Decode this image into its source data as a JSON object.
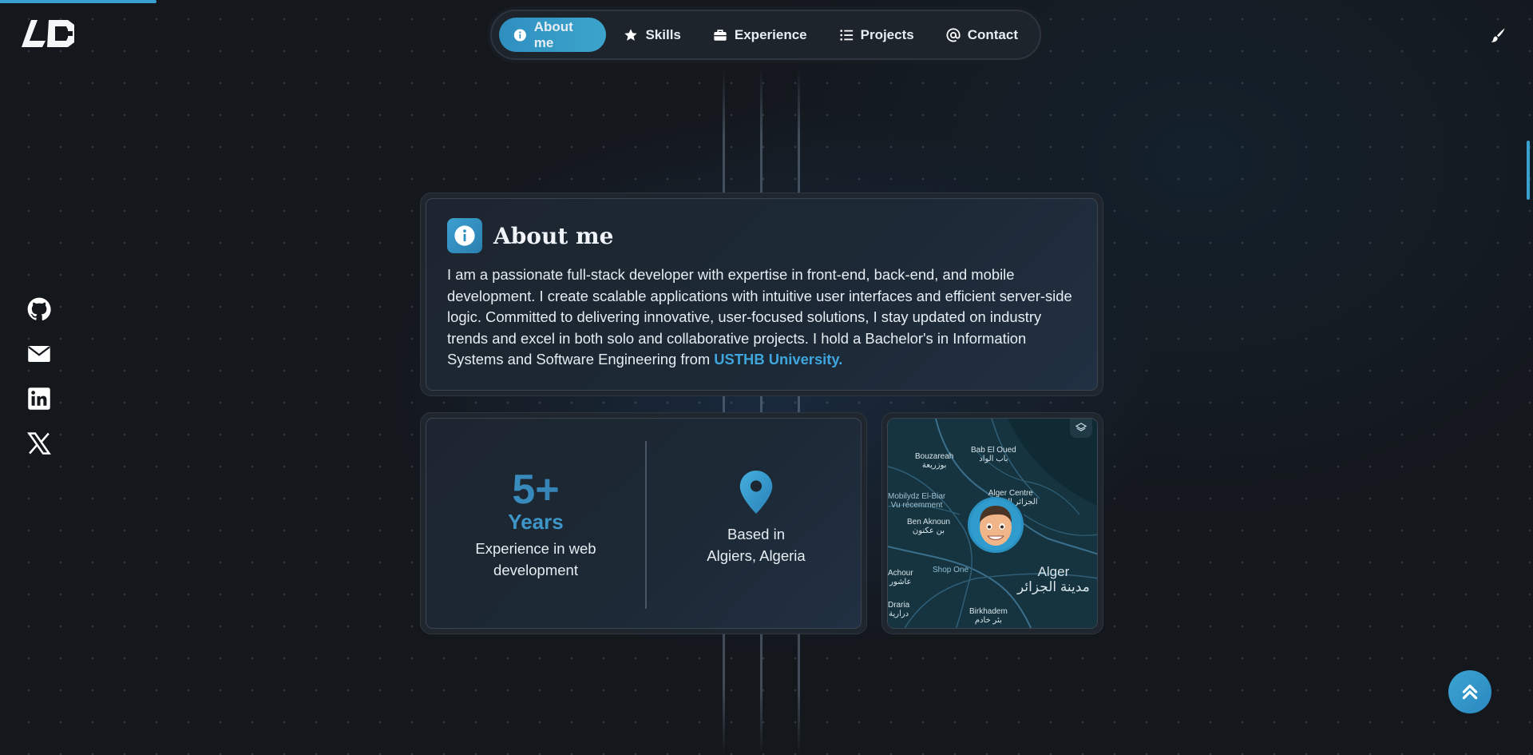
{
  "header": {
    "logo_text": "LD",
    "theme_icon": "brush-icon"
  },
  "nav": {
    "items": [
      {
        "label": "About me",
        "icon": "info-icon",
        "active": true
      },
      {
        "label": "Skills",
        "icon": "star-icon",
        "active": false
      },
      {
        "label": "Experience",
        "icon": "briefcase-icon",
        "active": false
      },
      {
        "label": "Projects",
        "icon": "list-icon",
        "active": false
      },
      {
        "label": "Contact",
        "icon": "at-icon",
        "active": false
      }
    ]
  },
  "socials": [
    {
      "icon": "github-icon"
    },
    {
      "icon": "mail-icon"
    },
    {
      "icon": "linkedin-icon"
    },
    {
      "icon": "x-icon"
    }
  ],
  "about": {
    "title": "About me",
    "text": "I am a passionate full-stack developer with expertise in front-end, back-end, and mobile development. I create scalable applications with intuitive user interfaces and efficient server-side logic. Committed to delivering innovative, user-focused solutions, I stay updated on industry trends and excel in both solo and collaborative projects. I hold a Bachelor's in Information Systems and Software Engineering from ",
    "link_text": "USTHB University."
  },
  "stats": {
    "years_number": "5+",
    "years_label": "Years",
    "years_caption_line1": "Experience in web",
    "years_caption_line2": "development",
    "location_line1": "Based in",
    "location_line2": "Algiers, Algeria"
  },
  "map": {
    "labels": [
      {
        "id": "bouzareah",
        "text": "Bouzareah",
        "ar": "بوزريعة"
      },
      {
        "id": "bab-el-oued",
        "text": "Bab El Oued",
        "ar": "باب الواد"
      },
      {
        "id": "alger-centre",
        "text": "Alger Centre",
        "ar": "الجزائر الوسطى"
      },
      {
        "id": "mobilydz",
        "text": "Mobilydz El-Biar",
        "ar": "Vu récemment"
      },
      {
        "id": "ben-aknoun",
        "text": "Ben Aknoun",
        "ar": "بن عكنون"
      },
      {
        "id": "achour",
        "text": "Achour",
        "ar": "عاشور"
      },
      {
        "id": "shop-one",
        "text": "Shop One",
        "ar": ""
      },
      {
        "id": "alger",
        "text": "Alger",
        "ar": "مدينة الجزائر"
      },
      {
        "id": "draria",
        "text": "Draria",
        "ar": "درارية"
      },
      {
        "id": "birkhadem",
        "text": "Birkhadem",
        "ar": "بئر خادم"
      }
    ]
  },
  "colors": {
    "accent": "#3aa0d0",
    "background": "#14171c",
    "card": "#1e2630"
  }
}
